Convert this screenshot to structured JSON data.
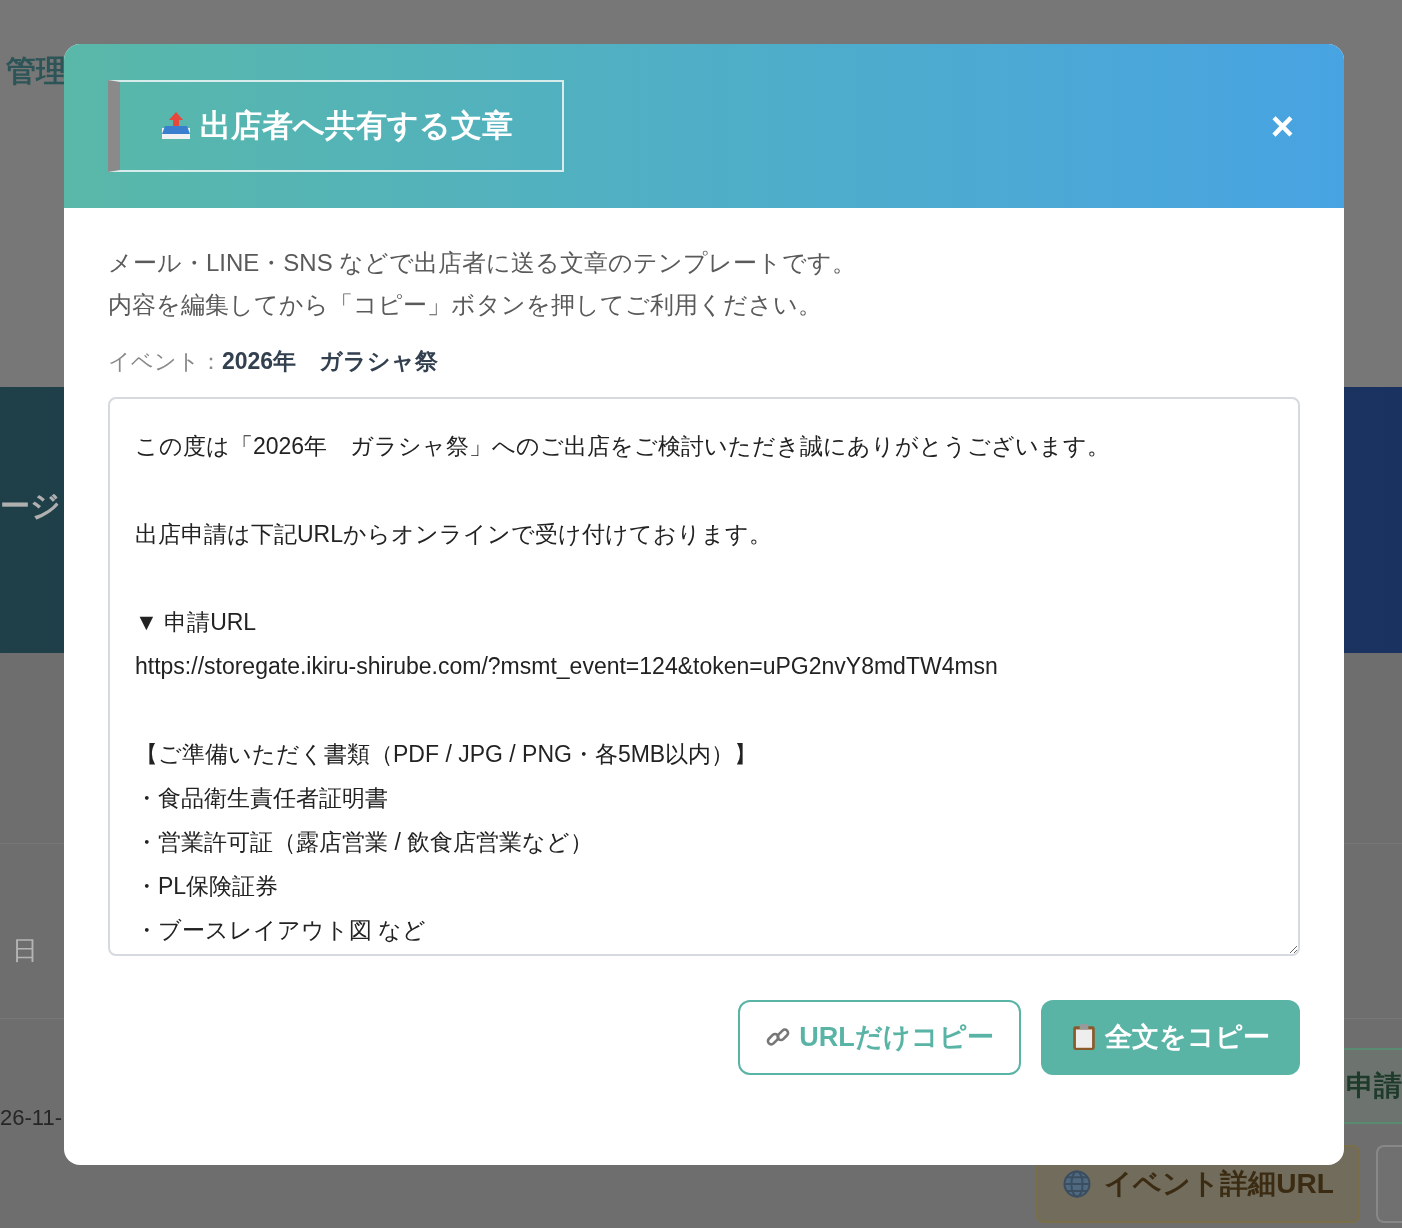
{
  "background": {
    "brand_fragment": "管理",
    "hero_fragment": "ージ",
    "cell_fragment": "日",
    "date_fragment": "26-11-",
    "apply_button": "申請",
    "event_url_button": "イベント詳細URL"
  },
  "modal": {
    "title": "出店者へ共有する文章",
    "close": "×",
    "description": [
      "メール・LINE・SNS などで出店者に送る文章のテンプレートです。",
      "内容を編集してから「コピー」ボタンを押してご利用ください。"
    ],
    "event_label": "イベント：",
    "event_name": "2026年　ガラシャ祭",
    "message_paragraphs": [
      [
        "この度は「2026年　ガラシャ祭」へのご出店をご検討いただき誠にありがとうございます。"
      ],
      [
        "出店申請は下記URLからオンラインで受け付けております。"
      ],
      [
        "▼ 申請URL",
        "https://storegate.ikiru-shirube.com/?msmt_event=124&token=uPG2nvY8mdTW4msn"
      ],
      [
        "【ご準備いただく書類（PDF / JPG / PNG・各5MB以内）】",
        "・食品衛生責任者証明書",
        "・営業許可証（露店営業 / 飲食店営業など）",
        "・PL保険証券",
        "・ブースレイアウト図 など"
      ]
    ],
    "buttons": [
      {
        "label": "URLだけコピー",
        "kind": "outline"
      },
      {
        "label": "全文をコピー",
        "kind": "primary"
      }
    ]
  }
}
